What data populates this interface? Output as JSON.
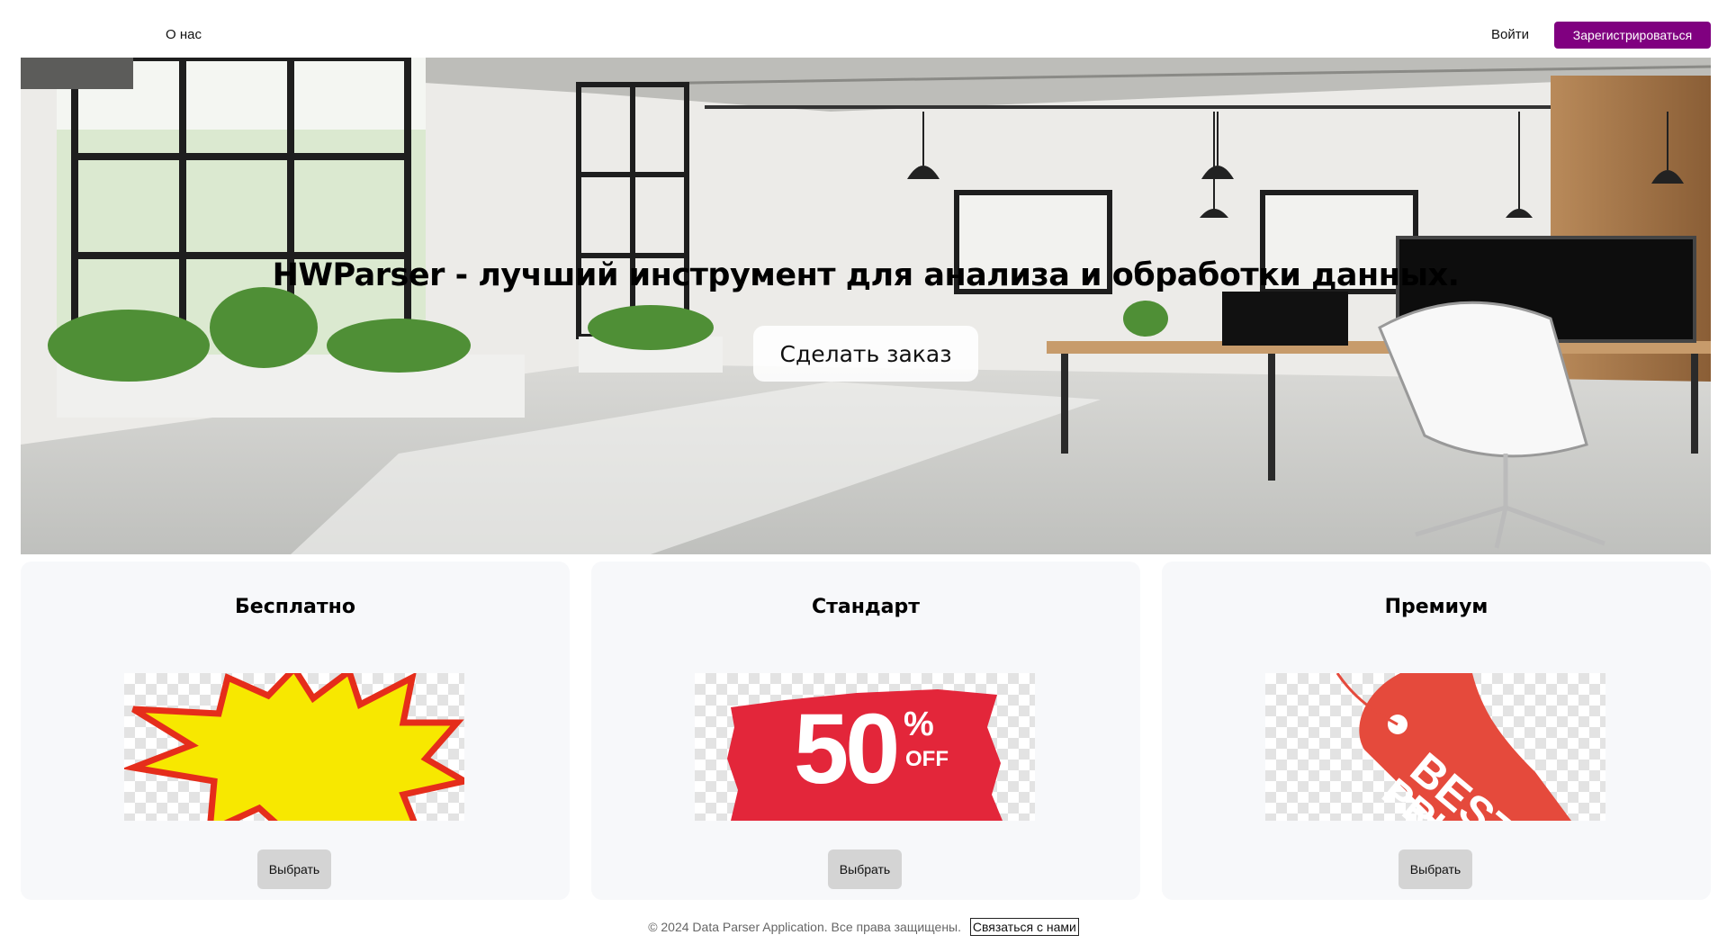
{
  "header": {
    "about_label": "О нас",
    "login_label": "Войти",
    "register_label": "Зарегистрироваться",
    "register_color": "#800080"
  },
  "hero": {
    "title": "HWParser - лучший инструмент для анализа и обработки данных.",
    "cta_label": "Сделать заказ",
    "background_image": "office-interior-photo"
  },
  "plans": [
    {
      "title": "Бесплатно",
      "image": "starburst-sticker",
      "button_label": "Выбрать"
    },
    {
      "title": "Стандарт",
      "image": "50-off-sticker",
      "sticker_number": "50",
      "sticker_percent": "%",
      "sticker_off": "OFF",
      "button_label": "Выбрать"
    },
    {
      "title": "Премиум",
      "image": "best-price-tag",
      "tag_text_1": "BEST",
      "tag_text_2": "PRIC",
      "button_label": "Выбрать"
    }
  ],
  "footer": {
    "copyright": "© 2024 Data Parser Application. Все права защищены.",
    "contact_label": "Связаться с нами"
  }
}
